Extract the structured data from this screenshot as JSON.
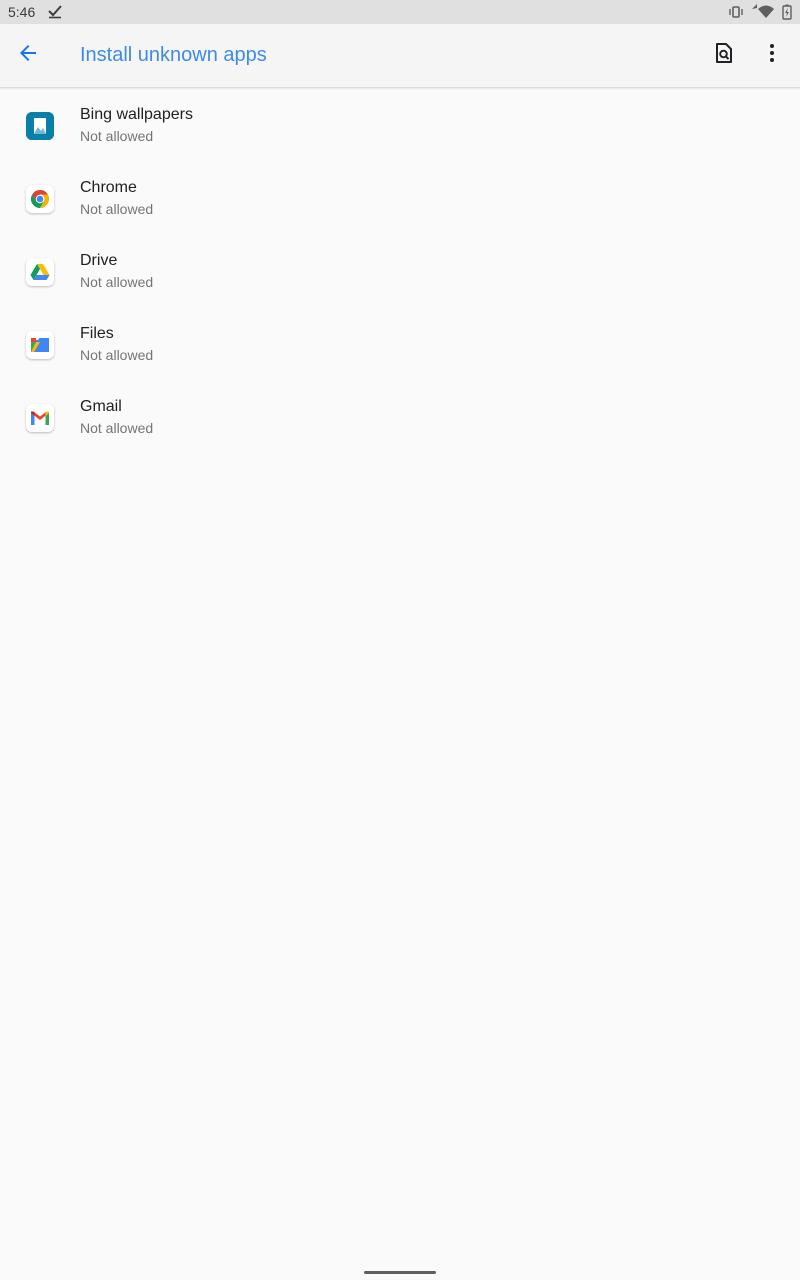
{
  "status_bar": {
    "time": "5:46",
    "icons": [
      "check-icon",
      "vibrate-icon",
      "wifi-icon",
      "battery-icon"
    ]
  },
  "app_bar": {
    "title": "Install unknown apps",
    "back_icon": "arrow-back-icon",
    "actions": [
      "search-settings-icon",
      "more-options-icon"
    ]
  },
  "apps": [
    {
      "name": "Bing wallpapers",
      "status": "Not allowed",
      "icon": "bing-wallpapers-icon"
    },
    {
      "name": "Chrome",
      "status": "Not allowed",
      "icon": "chrome-icon"
    },
    {
      "name": "Drive",
      "status": "Not allowed",
      "icon": "drive-icon"
    },
    {
      "name": "Files",
      "status": "Not allowed",
      "icon": "files-icon"
    },
    {
      "name": "Gmail",
      "status": "Not allowed",
      "icon": "gmail-icon"
    }
  ],
  "colors": {
    "accent": "#3d8be8",
    "background": "#fafafa",
    "status_bar": "#e0e0e0"
  }
}
